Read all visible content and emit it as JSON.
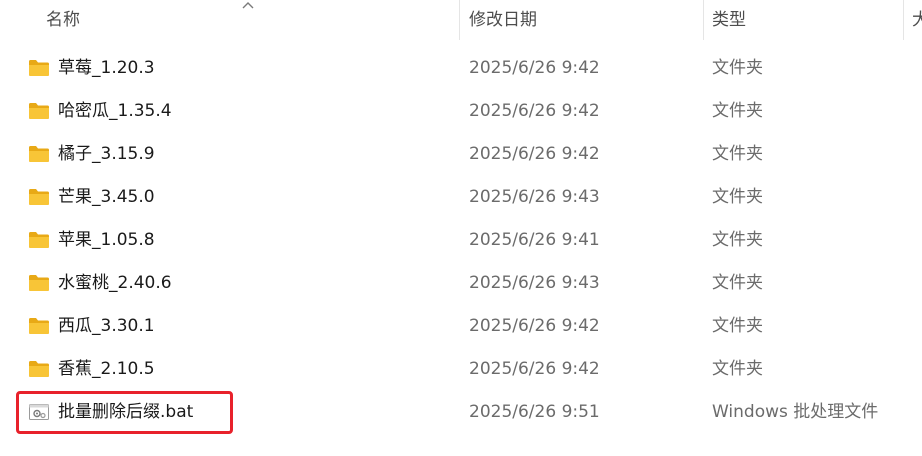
{
  "columns": {
    "name": "名称",
    "date_modified": "修改日期",
    "type": "类型",
    "size_partial": "大"
  },
  "files": [
    {
      "name": "草莓_1.20.3",
      "date": "2025/6/26 9:42",
      "type": "文件夹",
      "icon": "folder-icon"
    },
    {
      "name": "哈密瓜_1.35.4",
      "date": "2025/6/26 9:42",
      "type": "文件夹",
      "icon": "folder-icon"
    },
    {
      "name": "橘子_3.15.9",
      "date": "2025/6/26 9:42",
      "type": "文件夹",
      "icon": "folder-icon"
    },
    {
      "name": "芒果_3.45.0",
      "date": "2025/6/26 9:43",
      "type": "文件夹",
      "icon": "folder-icon"
    },
    {
      "name": "苹果_1.05.8",
      "date": "2025/6/26 9:41",
      "type": "文件夹",
      "icon": "folder-icon"
    },
    {
      "name": "水蜜桃_2.40.6",
      "date": "2025/6/26 9:43",
      "type": "文件夹",
      "icon": "folder-icon"
    },
    {
      "name": "西瓜_3.30.1",
      "date": "2025/6/26 9:42",
      "type": "文件夹",
      "icon": "folder-icon"
    },
    {
      "name": "香蕉_2.10.5",
      "date": "2025/6/26 9:42",
      "type": "文件夹",
      "icon": "folder-icon"
    },
    {
      "name": "批量删除后缀.bat",
      "date": "2025/6/26 9:51",
      "type": "Windows 批处理文件",
      "icon": "batch-file-icon"
    }
  ],
  "colors": {
    "folder": "#f8c537",
    "folder_dark": "#e8a916",
    "highlight": "#e8212b"
  }
}
